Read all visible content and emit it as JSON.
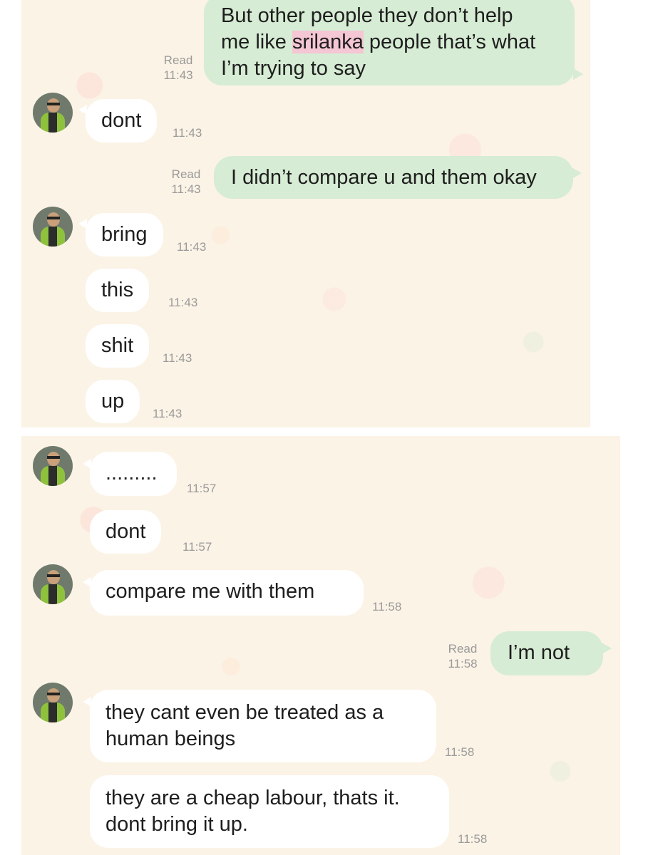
{
  "top_panel": {
    "messages": [
      {
        "from": "me",
        "text_pre": "But other people they don’t help\nme like ",
        "text_highlight": "srilanka",
        "text_post": " people that’s what\nI’m trying to say",
        "status": "Read",
        "time": "11:43"
      },
      {
        "from": "them",
        "text": "dont",
        "time": "11:43"
      },
      {
        "from": "me",
        "text": "I didn’t compare u and them okay",
        "status": "Read",
        "time": "11:43"
      },
      {
        "from": "them",
        "text": "bring",
        "time": "11:43"
      },
      {
        "from": "them",
        "text": "this",
        "time": "11:43"
      },
      {
        "from": "them",
        "text": "shit",
        "time": "11:43"
      },
      {
        "from": "them",
        "text": "up",
        "time": "11:43"
      }
    ]
  },
  "bottom_panel": {
    "messages": [
      {
        "from": "them",
        "text": ".........",
        "time": "11:57"
      },
      {
        "from": "them",
        "text": "dont",
        "time": "11:57"
      },
      {
        "from": "them",
        "text": "compare me with them",
        "time": "11:58"
      },
      {
        "from": "me",
        "text": "I’m not",
        "status": "Read",
        "time": "11:58"
      },
      {
        "from": "them",
        "text": "they cant even be treated as a\nhuman beings",
        "time": "11:58"
      },
      {
        "from": "them",
        "text": "they are a cheap labour, thats it.\ndont bring it up.",
        "time": "11:58"
      }
    ]
  },
  "colors": {
    "chat_background": "#fbf3e6",
    "outgoing_bubble": "#d6ecd4",
    "incoming_bubble": "#ffffff",
    "highlight": "#f5c6d4",
    "timestamp": "#9a9a9a"
  },
  "icons": {
    "avatar": "contact-avatar-icon"
  }
}
